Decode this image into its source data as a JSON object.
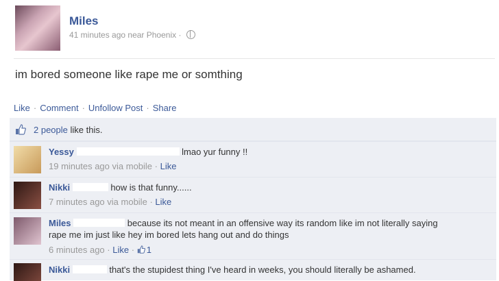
{
  "post": {
    "author": "Miles",
    "meta": "41 minutes ago near Phoenix",
    "meta_sep": "·",
    "text": "im bored someone like rape me or somthing"
  },
  "actions": {
    "like": "Like",
    "comment": "Comment",
    "unfollow": "Unfollow Post",
    "share": "Share",
    "sep": "·"
  },
  "likes": {
    "count_text": "2 people",
    "suffix": " like this."
  },
  "comments": [
    {
      "name": "Yessy",
      "text": "lmao yur funny !!",
      "meta": "19 minutes ago via mobile",
      "like": "Like",
      "avatar_color": "#e8c98d"
    },
    {
      "name": "Nikki",
      "text": "how is that funny......",
      "meta": "7 minutes ago via mobile",
      "like": "Like",
      "avatar_color": "#5a2f2a"
    },
    {
      "name": "Miles",
      "text_line1": "because its not meant in an offensive way its random like im not literally saying",
      "text_line2": "rape me im just like hey im bored lets hang out and do things",
      "meta": "6 minutes ago",
      "like": "Like",
      "like_count": "1",
      "avatar_color": "#b48a9e"
    },
    {
      "name": "Nikki",
      "text": "that's the stupidest thing I've heard in weeks, you should literally be ashamed.",
      "avatar_color": "#5a2f2a"
    }
  ]
}
